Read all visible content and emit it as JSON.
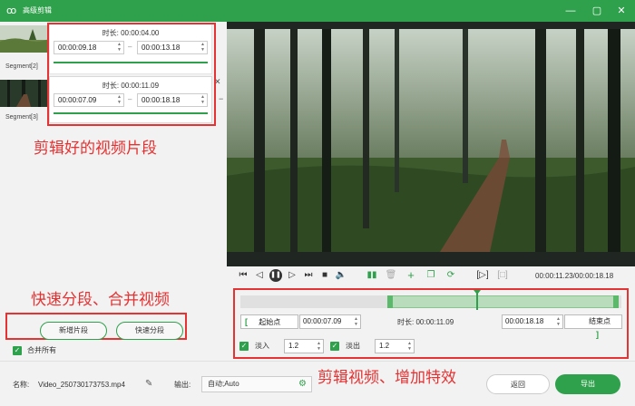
{
  "window": {
    "title": "高级剪辑"
  },
  "segments": [
    {
      "label": "Segment[2]",
      "duration_label": "时长:",
      "duration": "00:00:04.00",
      "start": "00:00:09.18",
      "end": "00:00:13.18"
    },
    {
      "label": "Segment[3]",
      "duration_label": "时长:",
      "duration": "00:00:11.09",
      "start": "00:00:07.09",
      "end": "00:00:18.18"
    }
  ],
  "annotations": {
    "segments": "剪辑好的视频片段",
    "split_merge": "快速分段、合并视频",
    "edit_effects": "剪辑视频、增加特效"
  },
  "left_actions": {
    "new_segment": "新增片段",
    "quick_split": "快速分段",
    "merge_all": "合并所有",
    "merge_all_checked": true
  },
  "player": {
    "time_current": "00:00:11.23",
    "time_total": "00:00:18.18",
    "progress_fraction": 0.62
  },
  "edit": {
    "start_label": "起始点",
    "start_value": "00:00:07.09",
    "duration_label": "时长:",
    "duration_value": "00:00:11.09",
    "end_value": "00:00:18.18",
    "end_label": "结束点",
    "fade_in_label": "淡入",
    "fade_in_value": "1.2",
    "fade_in_checked": true,
    "fade_out_label": "淡出",
    "fade_out_value": "1.2",
    "fade_out_checked": true
  },
  "bottom": {
    "name_label": "名称:",
    "file_name": "Video_250730173753.mp4",
    "output_label": "输出:",
    "output_value": "自动;Auto",
    "back_button": "返回",
    "export_button": "导出"
  },
  "colors": {
    "accent": "#2fa04b",
    "annotation": "#e53232"
  }
}
